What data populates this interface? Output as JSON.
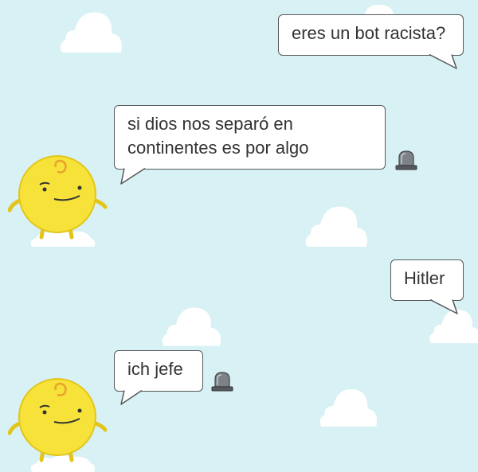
{
  "colors": {
    "background": "#d8f1f4",
    "cloud": "#ffffff",
    "bubble_border": "#56595c",
    "bubble_text": "#333333",
    "avatar_body": "#f7e23a",
    "avatar_outline": "#e3c51a",
    "report_icon": "#7d8287"
  },
  "conversation": [
    {
      "sender": "user",
      "text": "eres un bot racista?"
    },
    {
      "sender": "bot",
      "line1": "si dios nos separó en",
      "line2": "continentes es por algo",
      "icon": "siren-report-icon",
      "avatar": "simsimi-avatar"
    },
    {
      "sender": "user",
      "text": "Hitler"
    },
    {
      "sender": "bot",
      "text": "ich jefe",
      "icon": "siren-report-icon",
      "avatar": "simsimi-avatar"
    }
  ]
}
